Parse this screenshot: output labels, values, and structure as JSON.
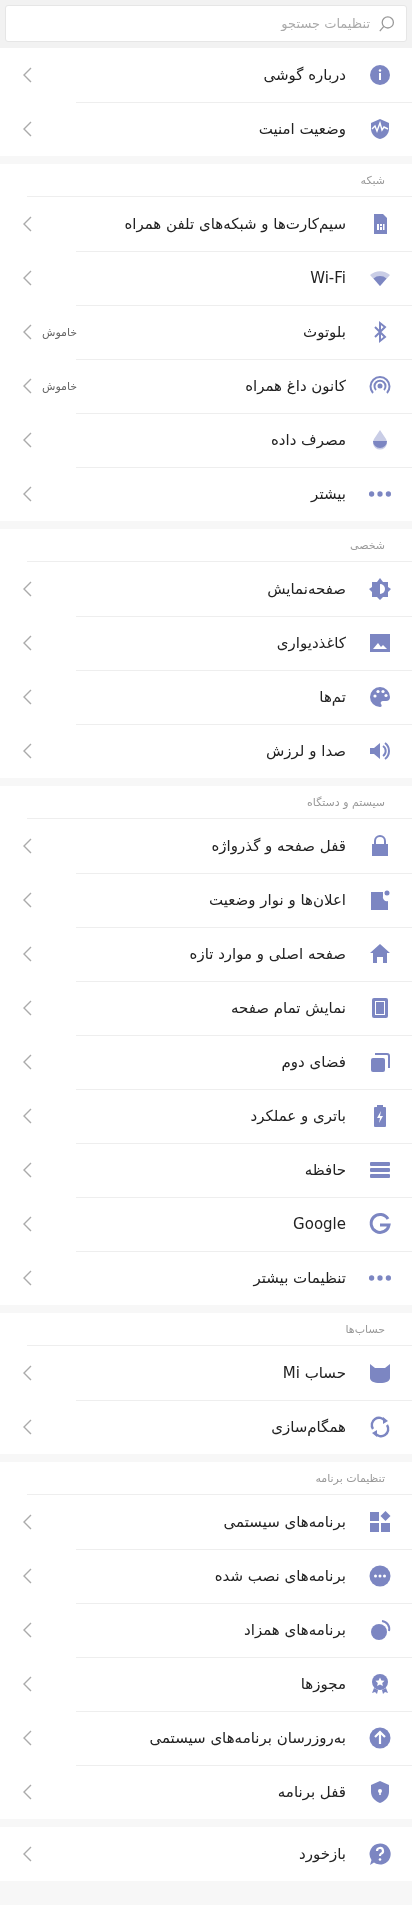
{
  "search": {
    "placeholder": "تنظیمات جستجو"
  },
  "sections": [
    {
      "items": [
        {
          "label": "درباره گوشی"
        },
        {
          "label": "وضعیت امنیت"
        }
      ]
    },
    {
      "header": "شبکه",
      "items": [
        {
          "label": "سیم‌کارت‌ها و شبکه‌های تلفن همراه"
        },
        {
          "label": "Wi-Fi"
        },
        {
          "label": "بلوتوث",
          "value": "خاموش"
        },
        {
          "label": "کانون داغ همراه",
          "value": "خاموش"
        },
        {
          "label": "مصرف داده"
        },
        {
          "label": "بیشتر"
        }
      ]
    },
    {
      "header": "شخصی",
      "items": [
        {
          "label": "صفحه‌نمایش"
        },
        {
          "label": "کاغذدیواری"
        },
        {
          "label": "تم‌ها"
        },
        {
          "label": "صدا و لرزش"
        }
      ]
    },
    {
      "header": "سیستم و دستگاه",
      "items": [
        {
          "label": "قفل صفحه و گذرواژه"
        },
        {
          "label": "اعلان‌ها و نوار وضعیت"
        },
        {
          "label": "صفحه اصلی و موارد تازه"
        },
        {
          "label": "نمایش تمام صفحه"
        },
        {
          "label": "فضای دوم"
        },
        {
          "label": "باتری و عملکرد"
        },
        {
          "label": "حافظه"
        },
        {
          "label": "Google"
        },
        {
          "label": "تنظیمات بیشتر"
        }
      ]
    },
    {
      "header": "حساب‌ها",
      "items": [
        {
          "label": "حساب Mi"
        },
        {
          "label": "همگام‌سازی"
        }
      ]
    },
    {
      "header": "تنظیمات برنامه",
      "items": [
        {
          "label": "برنامه‌های سیستمی"
        },
        {
          "label": "برنامه‌های نصب شده"
        },
        {
          "label": "برنامه‌های همزاد"
        },
        {
          "label": "مجوزها"
        },
        {
          "label": "به‌روزرسان برنامه‌های سیستمی"
        },
        {
          "label": "قفل برنامه"
        }
      ]
    },
    {
      "items": [
        {
          "label": "بازخورد"
        }
      ]
    }
  ]
}
